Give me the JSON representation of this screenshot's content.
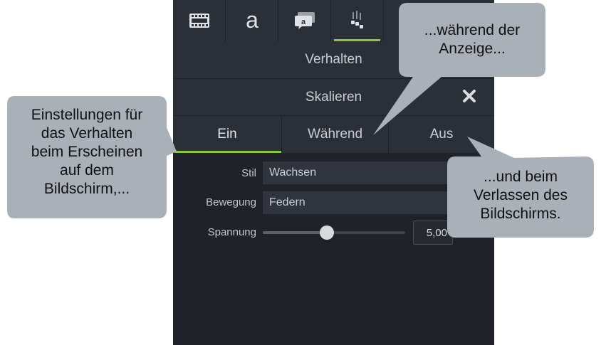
{
  "behavior_row": {
    "label": "Verhalten"
  },
  "effect_row": {
    "label": "Skalieren"
  },
  "phase_tabs": [
    {
      "label": "Ein"
    },
    {
      "label": "Während"
    },
    {
      "label": "Aus"
    }
  ],
  "properties": {
    "style": {
      "label": "Stil",
      "value": "Wachsen"
    },
    "motion": {
      "label": "Bewegung",
      "value": "Federn"
    },
    "tension": {
      "label": "Spannung",
      "value": "5,00",
      "fraction": 0.45
    }
  },
  "callouts": {
    "left": {
      "lines": [
        "Einstellungen für",
        "das Verhalten",
        "beim Erscheinen",
        "auf dem",
        "Bildschirm,..."
      ]
    },
    "top": {
      "lines": [
        "...während der",
        "Anzeige..."
      ]
    },
    "right": {
      "lines": [
        "...und beim",
        "Verlassen des",
        "Bildschirms."
      ]
    }
  },
  "colors": {
    "accent": "#8cc63f",
    "panel_background": "#1f2329",
    "callout_fill": "#aab0b8"
  },
  "icons": {
    "tab_1": "film-strip-icon",
    "tab_2": "annotation-letter-a-icon",
    "tab_3": "callout-bubble-icon",
    "tab_4": "behaviors-icon",
    "close": "close-x-icon"
  }
}
